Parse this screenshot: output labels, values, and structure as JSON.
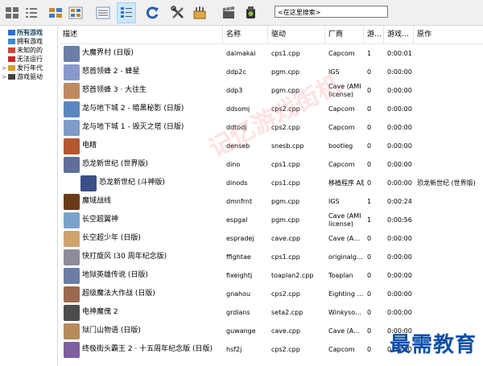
{
  "toolbar": {
    "buttons": [
      {
        "name": "view-large-icons-button",
        "active": false
      },
      {
        "name": "view-small-icons-button",
        "active": false
      },
      {
        "name": "view-list-button",
        "active": false
      },
      {
        "name": "view-details-button",
        "active": false
      },
      {
        "name": "view-grouped-button",
        "active": false
      },
      {
        "name": "view-tree-button",
        "active": true
      },
      {
        "name": "refresh-button",
        "active": false
      },
      {
        "name": "settings-button",
        "active": false
      },
      {
        "name": "options-button",
        "active": false
      },
      {
        "name": "video-button",
        "active": false
      },
      {
        "name": "audit-button",
        "active": false
      }
    ],
    "search_placeholder": "<在这里搜索>"
  },
  "sidebar": {
    "items": [
      {
        "label": "所有游戏",
        "color": "#2b6fd6",
        "expander": "",
        "selected": true
      },
      {
        "label": "拥有游戏",
        "color": "#3c8ad8",
        "expander": "",
        "selected": false
      },
      {
        "label": "未知的的",
        "color": "#d0463a",
        "expander": "",
        "selected": false
      },
      {
        "label": "无法运行",
        "color": "#c62828",
        "expander": "",
        "selected": false
      },
      {
        "label": "发行年代",
        "color": "#d79b2e",
        "expander": ">",
        "selected": false
      },
      {
        "label": "游戏驱动",
        "color": "#444444",
        "expander": ">",
        "selected": false
      }
    ]
  },
  "columns": [
    "描述",
    "名称",
    "驱动",
    "厂商",
    "游…",
    "游戏…",
    "原作"
  ],
  "rows": [
    {
      "desc": "大魔界村 (日版)",
      "name": "daimakai",
      "driver": "cps1.cpp",
      "maker": "Capcom",
      "players": "1",
      "time": "0:00:01",
      "parent": "",
      "color": "#6b7fa8"
    },
    {
      "desc": "怒首领蜂 2 - 蜂星",
      "name": "ddp2c",
      "driver": "pgm.cpp",
      "maker": "IGS",
      "players": "0",
      "time": "0:00:00",
      "parent": "",
      "color": "#8899cc"
    },
    {
      "desc": "怒首领蜂 3 · 大往生",
      "name": "ddp3",
      "driver": "pgm.cpp",
      "maker": "Cave (AMI license)",
      "players": "0",
      "time": "0:00:00",
      "parent": "",
      "color": "#c08a60"
    },
    {
      "desc": "龙与地下城 2 - 暗黑秘影 (日版)",
      "name": "ddsomj",
      "driver": "cps2.cpp",
      "maker": "Capcom",
      "players": "0",
      "time": "0:00:00",
      "parent": "",
      "color": "#5c86c0"
    },
    {
      "desc": "龙与地下城 1 - 毁灭之塔 (日版)",
      "name": "ddtodj",
      "driver": "cps2.cpp",
      "maker": "Capcom",
      "players": "0",
      "time": "0:00:00",
      "parent": "",
      "color": "#7f9cc8"
    },
    {
      "desc": "电精",
      "name": "denseb",
      "driver": "snesb.cpp",
      "maker": "bootleg",
      "players": "0",
      "time": "0:00:00",
      "parent": "",
      "color": "#b5572e"
    },
    {
      "desc": "恐龙新世纪 (世界版)",
      "name": "dino",
      "driver": "cps1.cpp",
      "maker": "Capcom",
      "players": "0",
      "time": "0:00:00",
      "parent": "",
      "color": "#5f6f9a"
    },
    {
      "desc": "恐龙新世纪 (斗神版)",
      "name": "dinods",
      "driver": "cps1.cpp",
      "maker": "移植程序 A版本",
      "players": "0",
      "time": "0:00:00",
      "parent": "恐龙新世纪 (世界版)",
      "color": "#3b4f88",
      "indent": true
    },
    {
      "desc": "魔域战线",
      "name": "dmnfrnt",
      "driver": "pgm.cpp",
      "maker": "IGS",
      "players": "1",
      "time": "0:00:24",
      "parent": "",
      "color": "#6a3b18"
    },
    {
      "desc": "长空超翼神",
      "name": "espgal",
      "driver": "pgm.cpp",
      "maker": "Cave (AMI license)",
      "players": "1",
      "time": "0:00:56",
      "parent": "",
      "color": "#7aa3cc"
    },
    {
      "desc": "长空超少年 (日版)",
      "name": "espradej",
      "driver": "cave.cpp",
      "maker": "Cave (A…",
      "players": "0",
      "time": "0:00:00",
      "parent": "",
      "color": "#cfa36e"
    },
    {
      "desc": "快打旋风 (30 周年纪念版)",
      "name": "ffightae",
      "driver": "cps1.cpp",
      "maker": "originalg…",
      "players": "0",
      "time": "0:00:00",
      "parent": "",
      "color": "#8c8c9a"
    },
    {
      "desc": "地狱英雄传说 (日版)",
      "name": "fixeightj",
      "driver": "toaplan2.cpp",
      "maker": "Toaplan",
      "players": "0",
      "time": "0:00:00",
      "parent": "",
      "color": "#6b7da5"
    },
    {
      "desc": "超级魔法大作战 (日版)",
      "name": "gnahou",
      "driver": "cps2.cpp",
      "maker": "Eighting …",
      "players": "0",
      "time": "0:00:00",
      "parent": "",
      "color": "#9b6a4e"
    },
    {
      "desc": "电神魔傀 2",
      "name": "grdians",
      "driver": "seta2.cpp",
      "maker": "Winkyso…",
      "players": "0",
      "time": "0:00:00",
      "parent": "",
      "color": "#4c4c4c"
    },
    {
      "desc": "狱门山物语 (日版)",
      "name": "guwange",
      "driver": "cave.cpp",
      "maker": "Cave (A…",
      "players": "0",
      "time": "0:00:00",
      "parent": "",
      "color": "#b88b5a"
    },
    {
      "desc": "终极街头霸王 2 · 十五周年纪念版 (日版)",
      "name": "hsf2j",
      "driver": "cps2.cpp",
      "maker": "Capcom",
      "players": "0",
      "time": "0:00:00",
      "parent": "",
      "color": "#7f5f9f"
    }
  ],
  "watermarks": {
    "center": "记忆游戏街机",
    "corner": "最需教育"
  }
}
